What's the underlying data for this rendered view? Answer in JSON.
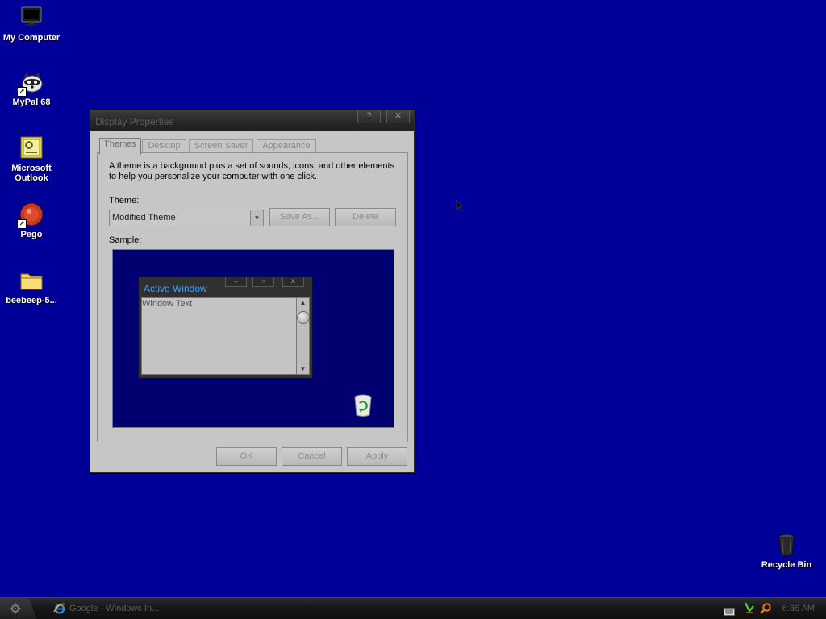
{
  "desktop": {
    "icons": [
      {
        "label": "My Computer",
        "icon": "computer-icon"
      },
      {
        "label": "MyPal 68",
        "icon": "mypal-icon"
      },
      {
        "label": "Microsoft Outlook",
        "icon": "outlook-icon"
      },
      {
        "label": "Pego",
        "icon": "pego-icon"
      },
      {
        "label": "beebeep-5...",
        "icon": "folder-icon"
      },
      {
        "label": "Recycle Bin",
        "icon": "recycle-bin-icon"
      }
    ]
  },
  "dialog": {
    "title": "Display Properties",
    "help_button": "?",
    "close_button": "✕",
    "tabs": [
      {
        "label": "Themes",
        "active": true
      },
      {
        "label": "Desktop",
        "active": false
      },
      {
        "label": "Screen Saver",
        "active": false
      },
      {
        "label": "Appearance",
        "active": false
      }
    ],
    "description_line1": "A theme is a background plus a set of sounds, icons, and other elements",
    "description_line2": "to help you personalize your computer with one click.",
    "theme_label": "Theme:",
    "theme_value": "Modified Theme",
    "save_as_label": "Save As...",
    "delete_label": "Delete",
    "sample_label": "Sample:",
    "sample": {
      "window_title": "Active Window",
      "window_text": "Window Text",
      "minimize": "–",
      "maximize": "▫",
      "close": "✕"
    },
    "ok_label": "OK",
    "cancel_label": "Cancel",
    "apply_label": "Apply"
  },
  "taskbar": {
    "task_label": "Google - Windows In...",
    "clock": "6:36 AM"
  },
  "colors": {
    "desktop": "#000098",
    "accent": "#3aa0ff"
  }
}
